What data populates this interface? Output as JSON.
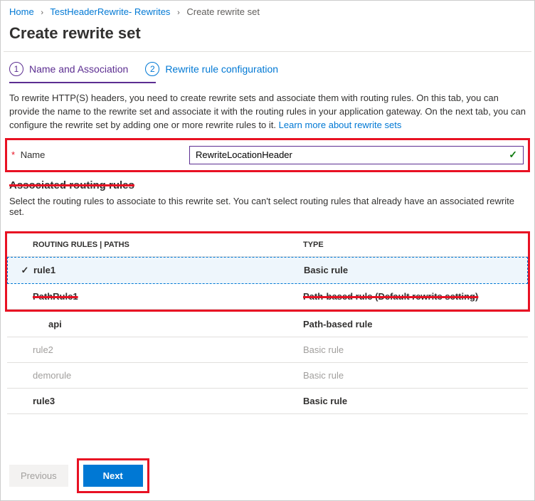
{
  "breadcrumb": {
    "home": "Home",
    "item1": "TestHeaderRewrite- Rewrites",
    "current": "Create rewrite set"
  },
  "page_title": "Create rewrite set",
  "tabs": {
    "t1_num": "1",
    "t1_label": "Name and Association",
    "t2_num": "2",
    "t2_label": "Rewrite rule configuration"
  },
  "description": "To rewrite HTTP(S) headers, you need to create rewrite sets and associate them with routing rules. On this tab, you can provide the name to the rewrite set and associate it with the routing rules in your application gateway. On the next tab, you can configure the rewrite set by adding one or more rewrite rules to it.  ",
  "learn_more": "Learn more about rewrite sets",
  "name_label": "Name",
  "name_value": "RewriteLocationHeader",
  "assoc_title": "Associated routing rules",
  "assoc_desc": "Select the routing rules to associate to this rewrite set. You can't select routing rules that already have an associated rewrite set.",
  "table": {
    "col_rules": "ROUTING RULES | PATHS",
    "col_type": "TYPE"
  },
  "rows": [
    {
      "name": "rule1",
      "type": "Basic rule"
    },
    {
      "name": "PathRule1",
      "type": "Path-based rule (Default rewrite setting)"
    },
    {
      "name": "api",
      "type": "Path-based rule"
    },
    {
      "name": "rule2",
      "type": "Basic rule"
    },
    {
      "name": "demorule",
      "type": "Basic rule"
    },
    {
      "name": "rule3",
      "type": "Basic rule"
    }
  ],
  "buttons": {
    "prev": "Previous",
    "next": "Next"
  }
}
